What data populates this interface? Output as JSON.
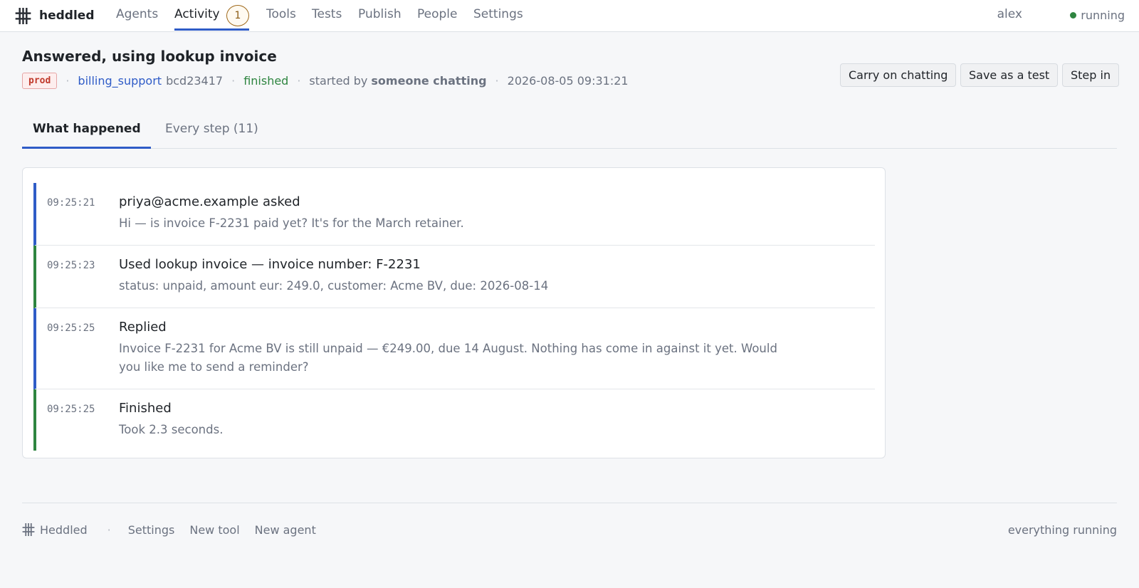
{
  "app": {
    "name": "heddled",
    "footer_name": "Heddled",
    "user": "alex",
    "status": "running"
  },
  "nav": {
    "agents": "Agents",
    "activity": "Activity",
    "activity_count": "1",
    "tools": "Tools",
    "tests": "Tests",
    "publish": "Publish",
    "people": "People",
    "settings": "Settings"
  },
  "run": {
    "title": "Answered, using lookup invoice",
    "environment": "prod",
    "agent": "billing_support",
    "version": "bcd23417",
    "state": "finished",
    "started_by_label": "started by",
    "started_by": "someone chatting",
    "timestamp": "2026-08-05 09:31:21",
    "separator": "·"
  },
  "actions": {
    "carry_on": "Carry on chatting",
    "save_test": "Save as a test",
    "step_in": "Step in"
  },
  "tabs": {
    "what_happened": "What happened",
    "every_step": "Every step (11)"
  },
  "events": [
    {
      "time": "09:25:21",
      "title": "priya@acme.example asked",
      "body": "Hi — is invoice F-2231 paid yet? It's for the March retainer.",
      "kind": "message"
    },
    {
      "time": "09:25:23",
      "title": "Used lookup invoice — invoice number: F-2231",
      "body": "status: unpaid, amount eur: 249.0, customer: Acme BV, due: 2026-08-14",
      "kind": "tool"
    },
    {
      "time": "09:25:25",
      "title": "Replied",
      "body": "Invoice F-2231 for Acme BV is still unpaid — €249.00, due 14 August. Nothing has come in against it yet. Would you like me to send a reminder?",
      "kind": "message"
    },
    {
      "time": "09:25:25",
      "title": "Finished",
      "body": "Took 2.3 seconds.",
      "kind": "tool"
    }
  ],
  "footer": {
    "separator": "·",
    "settings": "Settings",
    "new_tool": "New tool",
    "new_agent": "New agent",
    "status": "everything running"
  },
  "colors": {
    "accent": "#2f5cc7",
    "message_bar": "#2f5cc7",
    "tool_bar": "#2e8540",
    "brand_icon": "#2b2f36",
    "env_tag": "#c0392b"
  },
  "icons": {
    "brand": "loom-hash-icon",
    "status": "status-dot-icon"
  }
}
